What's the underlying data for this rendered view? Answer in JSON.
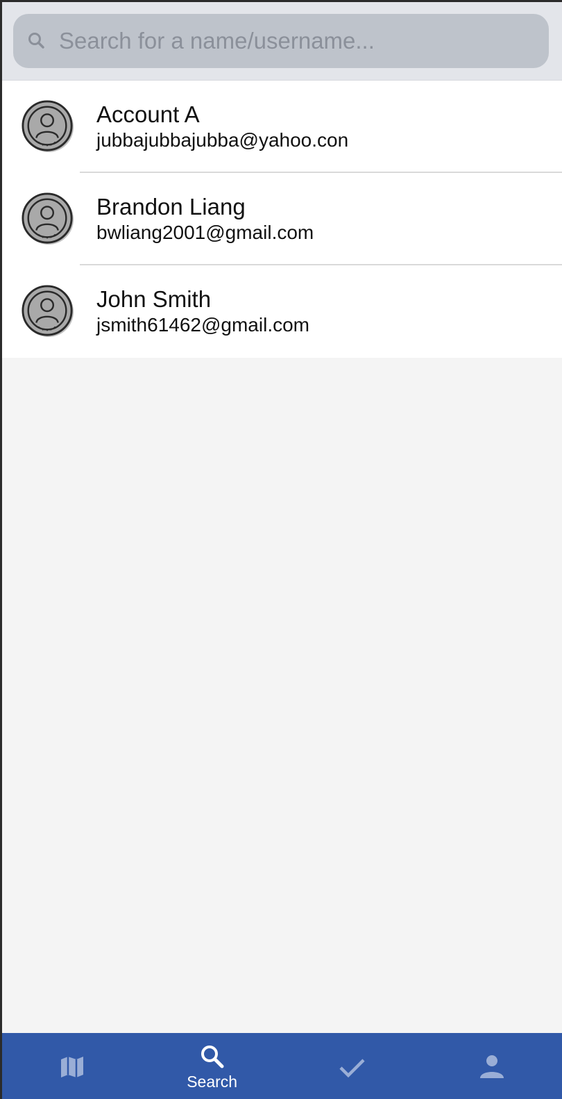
{
  "search": {
    "placeholder": "Search for a name/username...",
    "value": ""
  },
  "results": [
    {
      "name": "Account A",
      "email": "jubbajubbajubba@yahoo.con"
    },
    {
      "name": "Brandon Liang",
      "email": "bwliang2001@gmail.com"
    },
    {
      "name": "John Smith",
      "email": "jsmith61462@gmail.com"
    }
  ],
  "tabbar": {
    "background": "#3159a8",
    "active_color": "#ffffff",
    "inactive_color": "#9aaed6",
    "tabs": [
      {
        "icon": "map-icon",
        "label": ""
      },
      {
        "icon": "search-icon",
        "label": "Search",
        "active": true
      },
      {
        "icon": "checkmark-icon",
        "label": ""
      },
      {
        "icon": "person-icon",
        "label": ""
      }
    ]
  }
}
